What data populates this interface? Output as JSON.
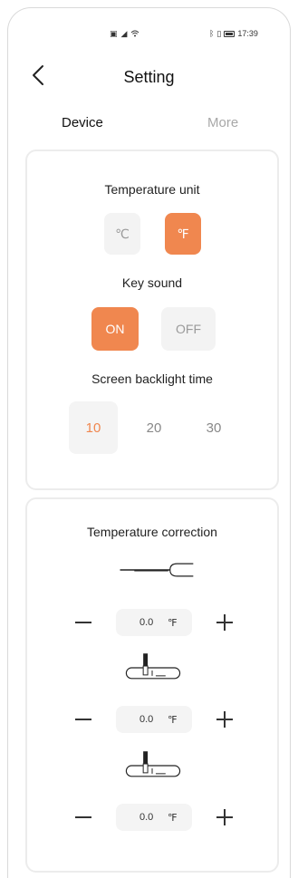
{
  "status_bar": {
    "left_icons": [
      "sim-card-icon",
      "signal-icon",
      "wifi-icon"
    ],
    "right_icons": [
      "bluetooth-icon",
      "vibrate-icon",
      "battery-icon"
    ],
    "time": "17:39"
  },
  "header": {
    "title": "Setting"
  },
  "tabs": [
    {
      "label": "Device",
      "active": true
    },
    {
      "label": "More",
      "active": false
    }
  ],
  "settings": {
    "temperature_unit": {
      "label": "Temperature unit",
      "options": [
        "℃",
        "℉"
      ],
      "selected": "℉"
    },
    "key_sound": {
      "label": "Key sound",
      "options": [
        "ON",
        "OFF"
      ],
      "selected": "ON"
    },
    "backlight": {
      "label": "Screen backlight time",
      "options": [
        "10",
        "20",
        "30"
      ],
      "selected": "10"
    }
  },
  "correction": {
    "label": "Temperature correction",
    "rows": [
      {
        "probe_icon": "external-probe-icon",
        "value": "0.0",
        "unit": "℉"
      },
      {
        "probe_icon": "grill-probe-icon",
        "value": "0.0",
        "unit": "℉"
      },
      {
        "probe_icon": "grill-probe-icon",
        "value": "0.0",
        "unit": "℉"
      }
    ]
  },
  "colors": {
    "accent": "#f0874f",
    "inactive_bg": "#f3f3f3",
    "card_border": "#ececec",
    "muted_text": "#a8a8a8"
  }
}
